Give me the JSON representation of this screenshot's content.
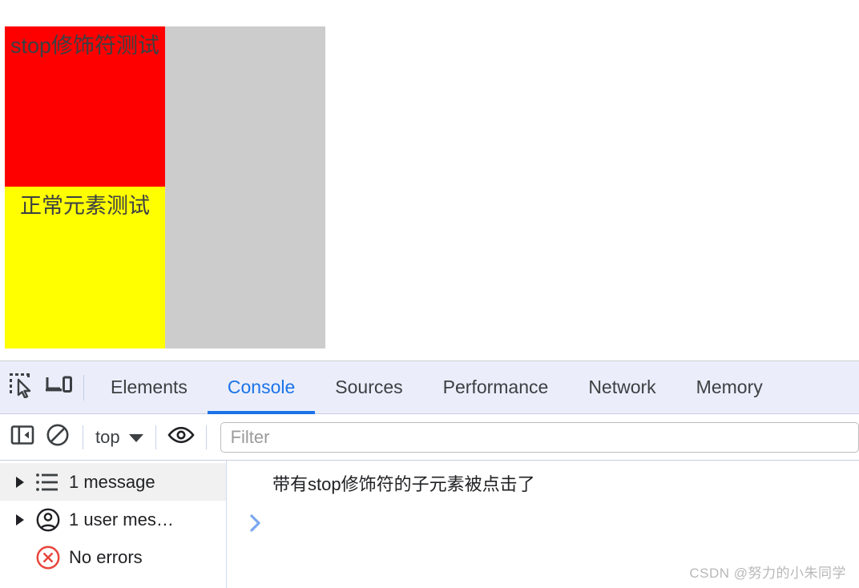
{
  "page": {
    "red_box_text": "stop修饰符测试",
    "yellow_box_text": "正常元素测试",
    "colors": {
      "red": "#ff0000",
      "yellow": "#ffff00",
      "container_gray": "#cccccc",
      "text": "#3c4043"
    }
  },
  "devtools": {
    "toolbar_icons": {
      "inspect": "inspect-element-icon",
      "device": "device-toolbar-icon"
    },
    "tabs": [
      {
        "label": "Elements",
        "active": false
      },
      {
        "label": "Console",
        "active": true
      },
      {
        "label": "Sources",
        "active": false
      },
      {
        "label": "Performance",
        "active": false
      },
      {
        "label": "Network",
        "active": false
      },
      {
        "label": "Memory",
        "active": false
      }
    ],
    "accent_color": "#1a73e8",
    "console_toolbar": {
      "sidebar_toggle": "sidebar-panel-icon",
      "clear": "clear-console-icon",
      "context": "top",
      "context_caret": "▼",
      "eye": "live-expression-icon",
      "filter_placeholder": "Filter",
      "filter_value": ""
    },
    "sidebar": [
      {
        "label": "1 message",
        "icon": "list-icon",
        "expandable": true,
        "selected": true
      },
      {
        "label": "1 user mes…",
        "icon": "user-icon",
        "expandable": true,
        "selected": false
      },
      {
        "label": "No errors",
        "icon": "error-circle-icon",
        "expandable": false,
        "selected": false
      }
    ],
    "messages": [
      {
        "text": "带有stop修饰符的子元素被点击了"
      }
    ],
    "prompt_symbol": "›"
  },
  "watermark": "CSDN @努力的小朱同学"
}
